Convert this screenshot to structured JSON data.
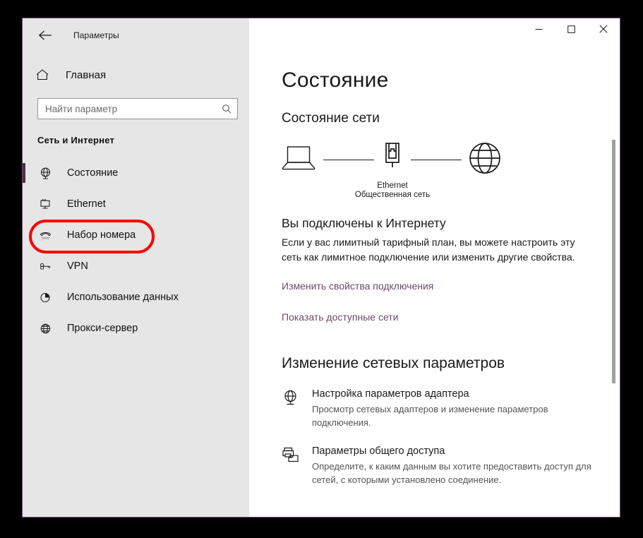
{
  "window": {
    "app_title": "Параметры",
    "back_icon": "back-arrow-icon",
    "minimize_label": "—",
    "maximize_label": "□",
    "close_label": "✕"
  },
  "sidebar": {
    "home": {
      "label": "Главная",
      "icon": "home-icon"
    },
    "search": {
      "placeholder": "Найти параметр",
      "value": "",
      "icon": "search-icon"
    },
    "group_title": "Сеть и Интернет",
    "items": [
      {
        "label": "Состояние",
        "icon": "globe-monitor-icon",
        "selected": true
      },
      {
        "label": "Ethernet",
        "icon": "ethernet-monitor-icon",
        "selected": false
      },
      {
        "label": "Набор номера",
        "icon": "telephone-icon",
        "selected": false
      },
      {
        "label": "VPN",
        "icon": "vpn-key-icon",
        "selected": false
      },
      {
        "label": "Использование данных",
        "icon": "pie-chart-icon",
        "selected": false
      },
      {
        "label": "Прокси-сервер",
        "icon": "globe-icon",
        "selected": false
      }
    ],
    "highlight": {
      "target": "Ethernet",
      "color": "#fb0000"
    }
  },
  "main": {
    "page_title": "Состояние",
    "network_status_heading": "Состояние сети",
    "diagram": {
      "device_icon": "laptop-icon",
      "adapter_icon": "ethernet-port-icon",
      "internet_icon": "globe-icon",
      "adapter_name": "Ethernet",
      "network_type": "Общественная сеть"
    },
    "connection_status": "Вы подключены к Интернету",
    "connection_description": "Если у вас лимитный тарифный план, вы можете настроить эту сеть как лимитное подключение или изменить другие свойства.",
    "links": [
      {
        "label": "Изменить свойства подключения"
      },
      {
        "label": "Показать доступные сети"
      }
    ],
    "change_settings_heading": "Изменение сетевых параметров",
    "settings": [
      {
        "title": "Настройка параметров адаптера",
        "description": "Просмотр сетевых адаптеров и изменение параметров подключения.",
        "icon": "globe-monitor-icon"
      },
      {
        "title": "Параметры общего доступа",
        "description": "Определите, к каким данным вы хотите предоставить доступ для сетей, с которыми установлено соединение.",
        "icon": "sharing-printer-folder-icon"
      }
    ]
  },
  "colors": {
    "accent": "#4c2f4c",
    "link": "#6b4a6b",
    "highlight": "#fb0000",
    "sidebar_bg": "#e6e6e6",
    "content_bg": "#ffffff"
  }
}
